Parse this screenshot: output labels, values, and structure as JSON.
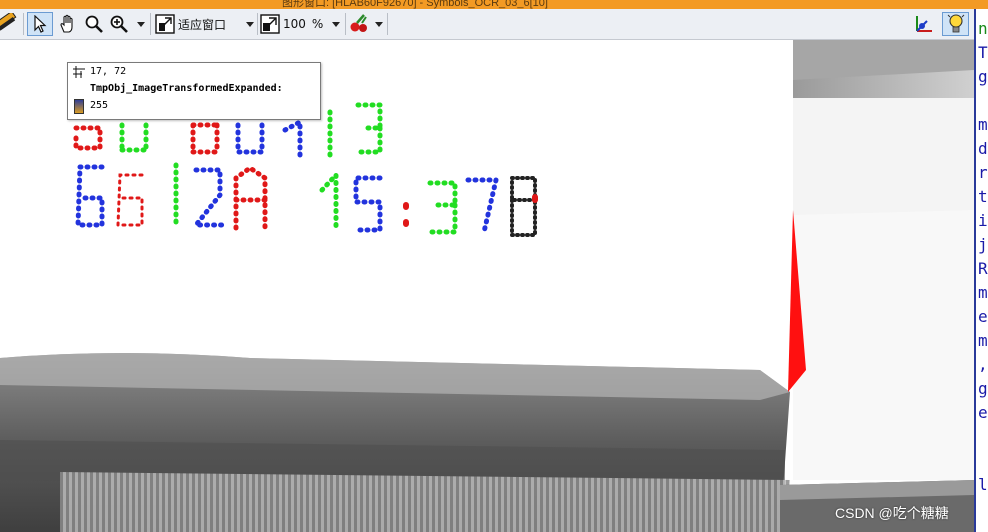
{
  "window": {
    "title_fragment": "图形窗口: [HLAB60F92670] - Symbols_OCR_03_6[10]",
    "accent_color": "#f39a24"
  },
  "toolbar": {
    "zoom_fit_label": "适应窗口",
    "zoom_percent": "100",
    "zoom_unit": "%"
  },
  "tooltip": {
    "coordinates": "17, 72",
    "object_name": "TmpObj_ImageTransformedExpanded:",
    "gray_value": "255"
  },
  "right_panel": {
    "visible_chars": [
      "n",
      "T",
      "g",
      "",
      "m",
      "d",
      "r",
      "t",
      "i",
      "j",
      "R",
      "m",
      "e",
      "m",
      ",",
      "g",
      "e",
      "",
      "",
      "l"
    ]
  },
  "watermark": "CSDN @吃个糖糖"
}
